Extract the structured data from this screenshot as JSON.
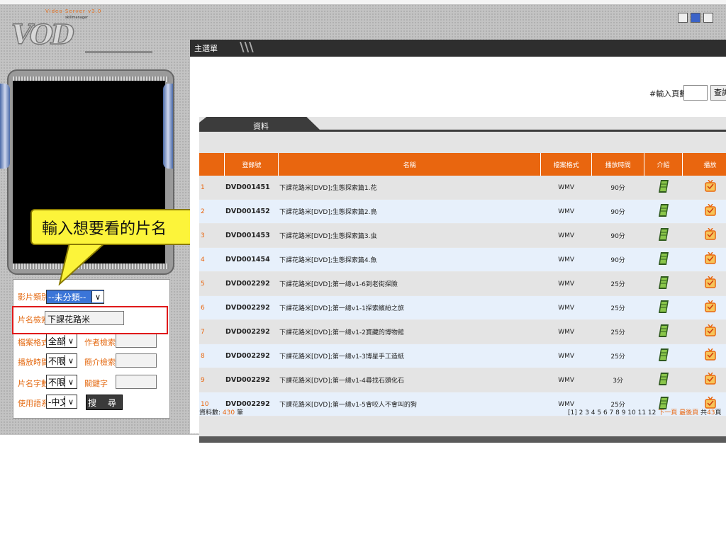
{
  "logo": {
    "version": "Video Server v3.0",
    "brand": "skillmanager"
  },
  "window": {
    "main_tab_title": "主選單"
  },
  "page_jump": {
    "label": "#輸入頁數",
    "button": "查詢"
  },
  "section_tab": {
    "label": "資料"
  },
  "table": {
    "headers": [
      "登錄號",
      "名稱",
      "檔案格式",
      "播放時間",
      "介紹",
      "播放"
    ],
    "rows": [
      {
        "no": "1",
        "code": "DVD001451",
        "name": "下課花路米[DVD];生態探索篇1.花",
        "format": "WMV",
        "duration": "90分"
      },
      {
        "no": "2",
        "code": "DVD001452",
        "name": "下課花路米[DVD];生態探索篇2.鳥",
        "format": "WMV",
        "duration": "90分"
      },
      {
        "no": "3",
        "code": "DVD001453",
        "name": "下課花路米[DVD];生態探索篇3.虫",
        "format": "WMV",
        "duration": "90分"
      },
      {
        "no": "4",
        "code": "DVD001454",
        "name": "下課花路米[DVD];生態探索篇4.魚",
        "format": "WMV",
        "duration": "90分"
      },
      {
        "no": "5",
        "code": "DVD002292",
        "name": "下課花路米[DVD];第一總v1-6到老街探險",
        "format": "WMV",
        "duration": "25分"
      },
      {
        "no": "6",
        "code": "DVD002292",
        "name": "下課花路米[DVD];第一總v1-1探索繽紛之旅",
        "format": "WMV",
        "duration": "25分"
      },
      {
        "no": "7",
        "code": "DVD002292",
        "name": "下課花路米[DVD];第一總v1-2寶藏的博物館",
        "format": "WMV",
        "duration": "25分"
      },
      {
        "no": "8",
        "code": "DVD002292",
        "name": "下課花路米[DVD];第一總v1-3博星手工造紙",
        "format": "WMV",
        "duration": "25分"
      },
      {
        "no": "9",
        "code": "DVD002292",
        "name": "下課花路米[DVD];第一總v1-4尋找石頭化石",
        "format": "WMV",
        "duration": "3分"
      },
      {
        "no": "10",
        "code": "DVD002292",
        "name": "下課花路米[DVD];第一總v1-5會咬人不會叫的狗",
        "format": "WMV",
        "duration": "25分"
      }
    ]
  },
  "footer": {
    "count_label": "資料數:",
    "count_value": "430",
    "count_unit": "筆",
    "pages": "[1] 2 3 4 5 6 7 8 9 10 11 12",
    "next": "下一頁",
    "last": "最後頁",
    "total_prefix": "共",
    "total_pages": "43",
    "total_suffix": "頁"
  },
  "search": {
    "category_label": "影片類別",
    "category_value": "--未分類--",
    "title_label": "片名檢索",
    "title_value": "下課花路米",
    "format_label": "檔案格式",
    "format_value": "全部",
    "author_label": "作者檢索",
    "duration_label": "播放時間",
    "duration_value": "不限",
    "summary_label": "簡介檢索",
    "chars_label": "片名字數",
    "chars_value": "不限",
    "keyword_label": "關鍵字",
    "lang_label": "使用語系",
    "lang_value": "-中文-",
    "search_button": "搜 尋"
  },
  "callout": {
    "text": "輸入想要看的片名"
  }
}
